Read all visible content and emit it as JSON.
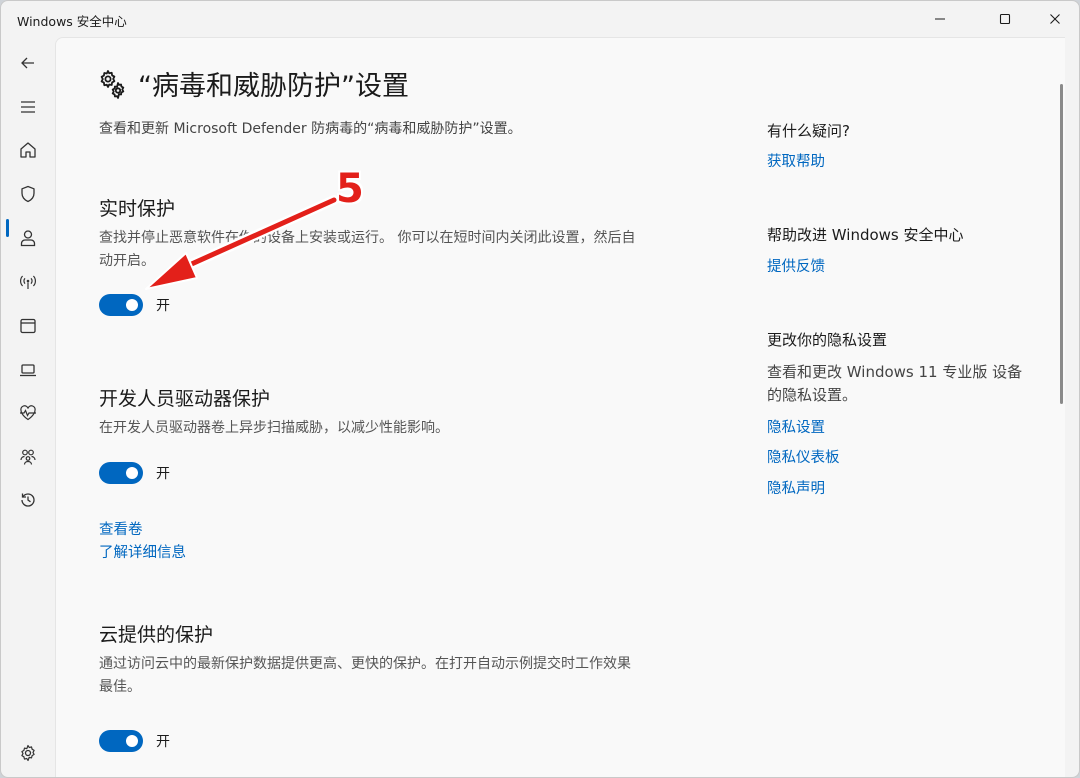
{
  "window": {
    "title": "Windows 安全中心",
    "controls": [
      "minimize-icon",
      "maximize-icon",
      "close-icon"
    ]
  },
  "nav": {
    "items": [
      {
        "name": "back",
        "icon": "back-arrow-icon"
      },
      {
        "name": "menu",
        "icon": "hamburger-icon"
      },
      {
        "name": "home",
        "icon": "home-icon"
      },
      {
        "name": "virus-protection",
        "icon": "shield-icon",
        "selected": true
      },
      {
        "name": "account-protection",
        "icon": "person-icon"
      },
      {
        "name": "firewall",
        "icon": "wifi-antenna-icon"
      },
      {
        "name": "app-browser",
        "icon": "window-icon"
      },
      {
        "name": "device-security",
        "icon": "laptop-icon"
      },
      {
        "name": "device-performance",
        "icon": "heart-pulse-icon"
      },
      {
        "name": "family-options",
        "icon": "family-icon"
      },
      {
        "name": "protection-history",
        "icon": "history-icon"
      },
      {
        "name": "settings",
        "icon": "gear-icon"
      }
    ],
    "accent": "#0067c0"
  },
  "page": {
    "title": "“病毒和威胁防护”设置",
    "description": "查看和更新 Microsoft Defender 防病毒的“病毒和威胁防护”设置。",
    "title_icon": "gears-icon"
  },
  "sections": [
    {
      "title": "实时保护",
      "description": "查找并停止恶意软件在你的设备上安装或运行。 你可以在短时间内关闭此设置，然后自动开启。",
      "toggle_state": "on",
      "toggle_label": "开"
    },
    {
      "title": "开发人员驱动器保护",
      "description": "在开发人员驱动器卷上异步扫描威胁，以减少性能影响。",
      "toggle_state": "on",
      "toggle_label": "开",
      "links": [
        "查看卷",
        "了解详细信息"
      ]
    },
    {
      "title": "云提供的保护",
      "description": "通过访问云中的最新保护数据提供更高、更快的保护。在打开自动示例提交时工作效果最佳。",
      "toggle_state": "on",
      "toggle_label": "开"
    }
  ],
  "sidebar": {
    "help": {
      "heading": "有什么疑问?",
      "link": "获取帮助"
    },
    "improve": {
      "heading": "帮助改进 Windows 安全中心",
      "link": "提供反馈"
    },
    "privacy": {
      "heading": "更改你的隐私设置",
      "text": "查看和更改 Windows 11 专业版 设备的隐私设置。",
      "links": [
        "隐私设置",
        "隐私仪表板",
        "隐私声明"
      ]
    }
  },
  "annotation": {
    "step_number": "5",
    "color": "#e3201a"
  }
}
